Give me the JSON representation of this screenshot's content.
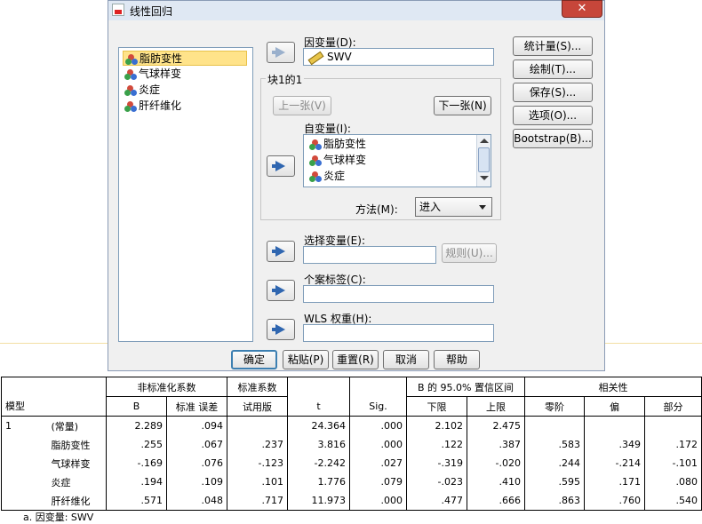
{
  "dialog": {
    "title": "线性回归",
    "close_symbol": "✕",
    "source_vars": [
      "脂肪变性",
      "气球样变",
      "炎症",
      "肝纤维化"
    ],
    "dependent_label": "因变量(D):",
    "dependent_value": "SWV",
    "block_label": "块1的1",
    "prev_button": "上一张(V)",
    "next_button": "下一张(N)",
    "independent_label": "自变量(I):",
    "independent_vars": [
      "脂肪变性",
      "气球样变",
      "炎症"
    ],
    "method_label": "方法(M):",
    "method_value": "进入",
    "selection_label": "选择变量(E):",
    "rule_button": "规则(U)...",
    "case_label_label": "个案标签(C):",
    "wls_label": "WLS 权重(H):",
    "side_buttons": [
      "统计量(S)...",
      "绘制(T)...",
      "保存(S)...",
      "选项(O)...",
      "Bootstrap(B)..."
    ],
    "bottom_buttons": [
      "确定",
      "粘贴(P)",
      "重置(R)",
      "取消",
      "帮助"
    ]
  },
  "table": {
    "header1": {
      "unstd": "非标准化系数",
      "std": "标准系数",
      "ci": "B 的 95.0% 置信区间",
      "corr": "相关性"
    },
    "header2": {
      "model": "模型",
      "b": "B",
      "se": "标准 误差",
      "beta": "试用版",
      "t": "t",
      "sig": "Sig.",
      "lower": "下限",
      "upper": "上限",
      "zero": "零阶",
      "partial": "偏",
      "part": "部分"
    },
    "model_number": "1",
    "rows": [
      {
        "name": "(常量)",
        "b": "2.289",
        "se": ".094",
        "beta": "",
        "t": "24.364",
        "sig": ".000",
        "lower": "2.102",
        "upper": "2.475",
        "zero": "",
        "partial": "",
        "part": ""
      },
      {
        "name": "脂肪变性",
        "b": ".255",
        "se": ".067",
        "beta": ".237",
        "t": "3.816",
        "sig": ".000",
        "lower": ".122",
        "upper": ".387",
        "zero": ".583",
        "partial": ".349",
        "part": ".172"
      },
      {
        "name": "气球样变",
        "b": "-.169",
        "se": ".076",
        "beta": "-.123",
        "t": "-2.242",
        "sig": ".027",
        "lower": "-.319",
        "upper": "-.020",
        "zero": ".244",
        "partial": "-.214",
        "part": "-.101"
      },
      {
        "name": "炎症",
        "b": ".194",
        "se": ".109",
        "beta": ".101",
        "t": "1.776",
        "sig": ".079",
        "lower": "-.023",
        "upper": ".410",
        "zero": ".595",
        "partial": ".171",
        "part": ".080"
      },
      {
        "name": "肝纤维化",
        "b": ".571",
        "se": ".048",
        "beta": ".717",
        "t": "11.973",
        "sig": ".000",
        "lower": ".477",
        "upper": ".666",
        "zero": ".863",
        "partial": ".760",
        "part": ".540"
      }
    ],
    "footnote": "a. 因变量: SWV"
  }
}
